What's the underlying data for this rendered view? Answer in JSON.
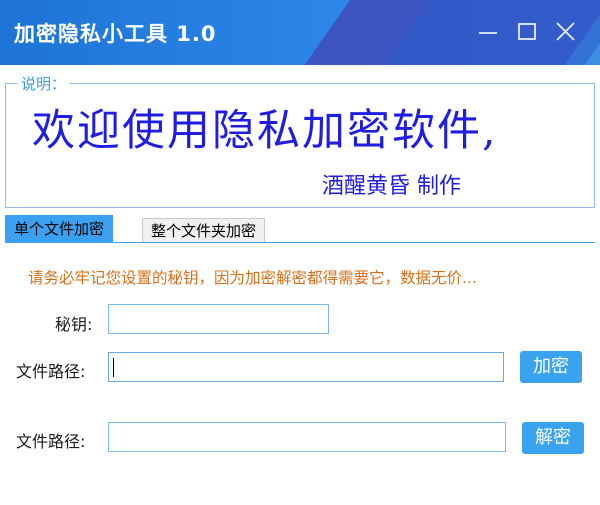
{
  "window": {
    "title": "加密隐私小工具 1.0",
    "controls": [
      "minimize-icon",
      "maximize-icon",
      "close-icon"
    ]
  },
  "description": {
    "legend": "说明：",
    "welcome": "欢迎使用隐私加密软件,",
    "credit": "酒醒黄昏 制作"
  },
  "tabs": [
    {
      "label": "单个文件加密",
      "active": true
    },
    {
      "label": "整个文件夹加密",
      "active": false
    }
  ],
  "panel": {
    "warning": "请务必牢记您设置的秘钥，因为加密解密都得需要它，数据无价...",
    "key_label": "秘钥:",
    "key_value": "",
    "encrypt": {
      "path_label": "文件路径:",
      "path_value": "",
      "button": "加密"
    },
    "decrypt": {
      "path_label": "文件路径:",
      "path_value": "",
      "button": "解密"
    }
  },
  "colors": {
    "titlebar": "#2b86e8",
    "accent": "#3aa0ef",
    "welcome_text": "#1f1ee0",
    "warning_text": "#d97019"
  }
}
